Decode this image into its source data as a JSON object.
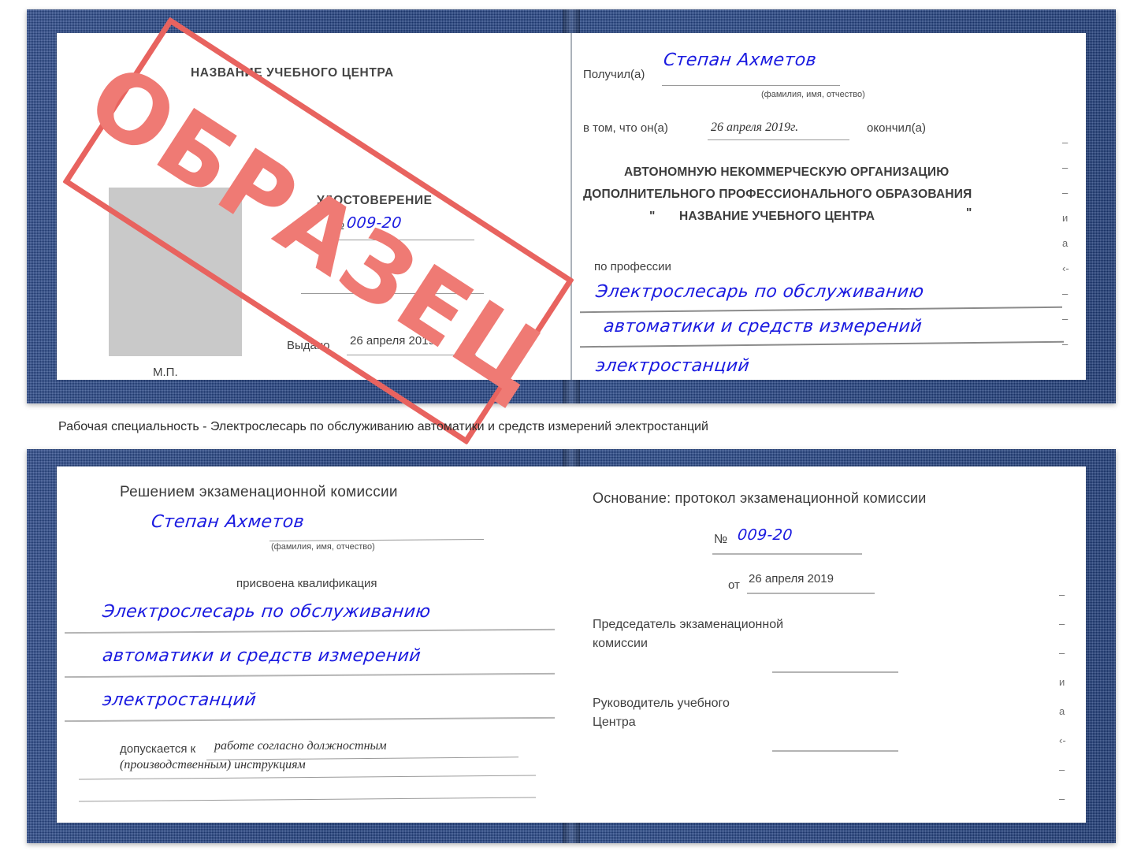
{
  "document": {
    "type": "Удостоверение",
    "stamp_label": "ОБРАЗЕЦ",
    "stamp_color": "#e8635f",
    "cover_color": "#24458a",
    "ink_color": "#1a1ae0"
  },
  "caption": {
    "text": "Рабочая специальность - Электрослесарь по обслуживанию автоматики и средств измерений электростанций"
  },
  "certificate_top": {
    "left_page": {
      "header": "НАЗВАНИЕ УЧЕБНОГО ЦЕНТРА",
      "title": "УДОСТОВЕРЕНИЕ",
      "number_label": "№",
      "number_value": "009-20",
      "issued_label": "Выдано",
      "issued_value": "26 апреля 2019",
      "seal_label": "М.П.",
      "photo_placeholder": "photo-area"
    },
    "right_page": {
      "received_label": "Получил(а)",
      "received_value": "Степан Ахметов",
      "received_hint": "(фамилия, имя, отчество)",
      "in_that_label": "в том, что он(а)",
      "in_that_value": "26 апреля 2019г.",
      "finished_label": "окончил(а)",
      "org_line1": "АВТОНОМНУЮ НЕКОММЕРЧЕСКУЮ ОРГАНИЗАЦИЮ",
      "org_line2": "ДОПОЛНИТЕЛЬНОГО ПРОФЕССИОНАЛЬНОГО ОБРАЗОВАНИЯ",
      "org_quote_open": "\"",
      "org_line3": "НАЗВАНИЕ УЧЕБНОГО ЦЕНТРА",
      "org_quote_close": "\"",
      "profession_label": "по профессии",
      "profession_line1": "Электрослесарь по обслуживанию",
      "profession_line2": "автоматики и средств измерений",
      "profession_line3": "электростанций",
      "edge_glyphs": [
        "–",
        "–",
        "–",
        "и",
        "а",
        "‹-",
        "–",
        "–",
        "–",
        "–"
      ]
    }
  },
  "certificate_bottom": {
    "left_page": {
      "decision_label": "Решением экзаменационной комиссии",
      "name_value": "Степан Ахметов",
      "name_hint": "(фамилия, имя, отчество)",
      "qualification_label": "присвоена квалификация",
      "qualification_line1": "Электрослесарь по обслуживанию",
      "qualification_line2": "автоматики и средств измерений",
      "qualification_line3": "электростанций",
      "admitted_label": "допускается к",
      "admitted_line1": "работе согласно должностным",
      "admitted_line2": "(производственным) инструкциям"
    },
    "right_page": {
      "basis_label": "Основание: протокол экзаменационной комиссии",
      "protocol_number_label": "№",
      "protocol_number_value": "009-20",
      "protocol_date_label": "от",
      "protocol_date_value": "26 апреля 2019",
      "chairman_line1": "Председатель экзаменационной",
      "chairman_line2": "комиссии",
      "head_line1": "Руководитель учебного",
      "head_line2": "Центра",
      "edge_glyphs": [
        "–",
        "–",
        "–",
        "и",
        "а",
        "‹-",
        "–",
        "–",
        "–",
        "–"
      ]
    }
  }
}
